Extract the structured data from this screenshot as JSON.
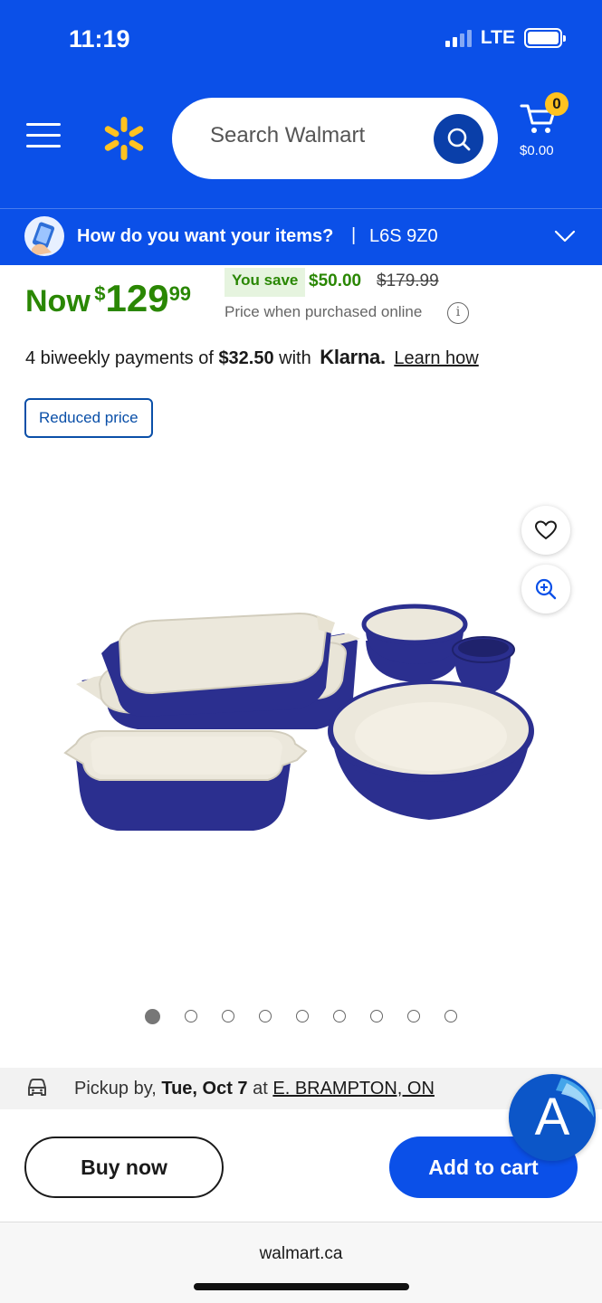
{
  "status_bar": {
    "time": "11:19",
    "network": "LTE"
  },
  "header": {
    "search": {
      "placeholder": "Search Walmart"
    },
    "cart": {
      "count": "0",
      "total": "$0.00"
    }
  },
  "delivery": {
    "question": "How do you want your items?",
    "separator": "|",
    "postal_code": "L6S 9Z0"
  },
  "price": {
    "now_label": "Now",
    "currency_symbol": "$",
    "whole": "129",
    "cents": "99",
    "you_save_label": "You save",
    "save_amount": "$50.00",
    "was_price": "$179.99",
    "note": "Price when purchased online"
  },
  "klarna": {
    "prefix": "4 biweekly payments of ",
    "amount": "$32.50",
    "with": " with ",
    "brand": "Klarna.",
    "learn_how": "Learn how"
  },
  "badge": {
    "label": "Reduced price"
  },
  "carousel": {
    "total": 9,
    "active": 0
  },
  "pickup": {
    "prefix": "Pickup by, ",
    "date": "Tue, Oct 7",
    "at": " at ",
    "store": "E. BRAMPTON, ON"
  },
  "actions": {
    "buy_now": "Buy now",
    "add_to_cart": "Add to cart"
  },
  "browser": {
    "url": "walmart.ca"
  },
  "colors": {
    "brand_blue": "#0b50e8",
    "spark_yellow": "#ffc220",
    "savings_green": "#2a8703",
    "cookware_blue": "#2b2f8f"
  }
}
